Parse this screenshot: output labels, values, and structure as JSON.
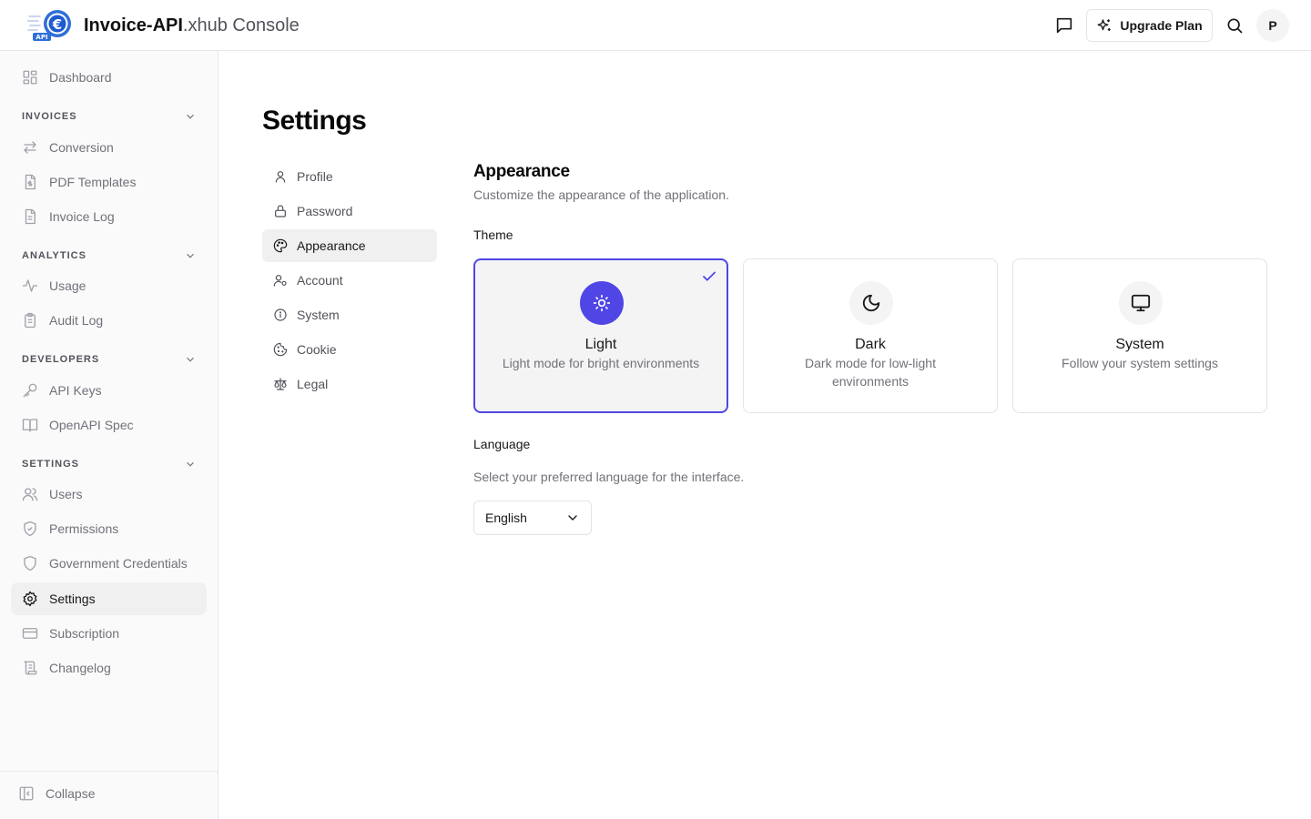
{
  "header": {
    "brand_bold": "Invoice-API",
    "brand_rest": ".xhub Console",
    "logo_text": "API",
    "upgrade_label": "Upgrade Plan",
    "avatar_initial": "P"
  },
  "sidebar": {
    "dashboard": "Dashboard",
    "sections": {
      "invoices": "INVOICES",
      "analytics": "ANALYTICS",
      "developers": "DEVELOPERS",
      "settings": "SETTINGS"
    },
    "items": {
      "conversion": "Conversion",
      "pdf_templates": "PDF Templates",
      "invoice_log": "Invoice Log",
      "usage": "Usage",
      "audit_log": "Audit Log",
      "api_keys": "API Keys",
      "openapi_spec": "OpenAPI Spec",
      "users": "Users",
      "permissions": "Permissions",
      "government_credentials": "Government Credentials",
      "settings": "Settings",
      "subscription": "Subscription",
      "changelog": "Changelog"
    },
    "collapse": "Collapse"
  },
  "main": {
    "title": "Settings",
    "subnav": {
      "profile": "Profile",
      "password": "Password",
      "appearance": "Appearance",
      "account": "Account",
      "system": "System",
      "cookie": "Cookie",
      "legal": "Legal"
    },
    "appearance": {
      "title": "Appearance",
      "description": "Customize the appearance of the application.",
      "theme_label": "Theme",
      "themes": {
        "light": {
          "name": "Light",
          "description": "Light mode for bright environments"
        },
        "dark": {
          "name": "Dark",
          "description": "Dark mode for low-light environments"
        },
        "system": {
          "name": "System",
          "description": "Follow your system settings"
        }
      },
      "selected_theme": "Light",
      "language_label": "Language",
      "language_description": "Select your preferred language for the interface.",
      "language_value": "English"
    }
  },
  "colors": {
    "accent": "#4f46e5",
    "sidebar_bg": "#fafafa",
    "active_bg": "#f0f0f1"
  }
}
